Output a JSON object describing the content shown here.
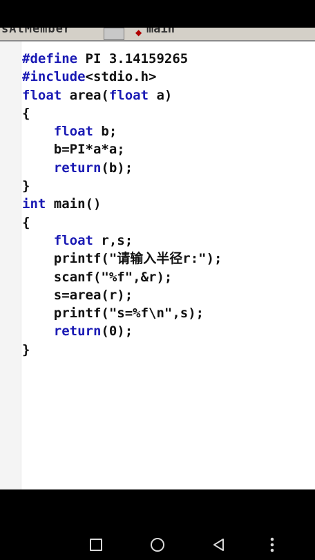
{
  "toolbar": {
    "left_text": "sAtMember",
    "right_text": "main",
    "icon": "diamond-icon"
  },
  "code_lines": [
    [
      {
        "t": "#define",
        "k": true
      },
      {
        "t": " PI 3.14159265",
        "k": false
      }
    ],
    [
      {
        "t": "#include",
        "k": true
      },
      {
        "t": "<stdio.h>",
        "k": false
      }
    ],
    [
      {
        "t": "float",
        "k": true
      },
      {
        "t": " area(",
        "k": false
      },
      {
        "t": "float",
        "k": true
      },
      {
        "t": " a)",
        "k": false
      }
    ],
    [
      {
        "t": "{",
        "k": false
      }
    ],
    [
      {
        "t": "    ",
        "k": false
      },
      {
        "t": "float",
        "k": true
      },
      {
        "t": " b;",
        "k": false
      }
    ],
    [
      {
        "t": "    b=PI*a*a;",
        "k": false
      }
    ],
    [
      {
        "t": "    ",
        "k": false
      },
      {
        "t": "return",
        "k": true
      },
      {
        "t": "(b);",
        "k": false
      }
    ],
    [
      {
        "t": "}",
        "k": false
      }
    ],
    [
      {
        "t": "int",
        "k": true
      },
      {
        "t": " main()",
        "k": false
      }
    ],
    [
      {
        "t": "{",
        "k": false
      }
    ],
    [
      {
        "t": "    ",
        "k": false
      },
      {
        "t": "float",
        "k": true
      },
      {
        "t": " r,s;",
        "k": false
      }
    ],
    [
      {
        "t": "    printf(\"请输入半径r:\");",
        "k": false
      }
    ],
    [
      {
        "t": "    scanf(\"%f\",&r);",
        "k": false
      }
    ],
    [
      {
        "t": "    s=area(r);",
        "k": false
      }
    ],
    [
      {
        "t": "    printf(\"s=%f\\n\",s);",
        "k": false
      }
    ],
    [
      {
        "t": "    ",
        "k": false
      },
      {
        "t": "return",
        "k": true
      },
      {
        "t": "(0);",
        "k": false
      }
    ],
    [
      {
        "t": "}",
        "k": false
      }
    ]
  ],
  "nav": {
    "recents_icon": "square-icon",
    "home_icon": "circle-icon",
    "back_icon": "triangle-back-icon",
    "menu_icon": "more-vertical-icon"
  },
  "colors": {
    "keyword": "#1a1ab4",
    "text": "#111111",
    "editor_bg": "#ffffff",
    "gutter_bg": "#f4f4f4"
  }
}
